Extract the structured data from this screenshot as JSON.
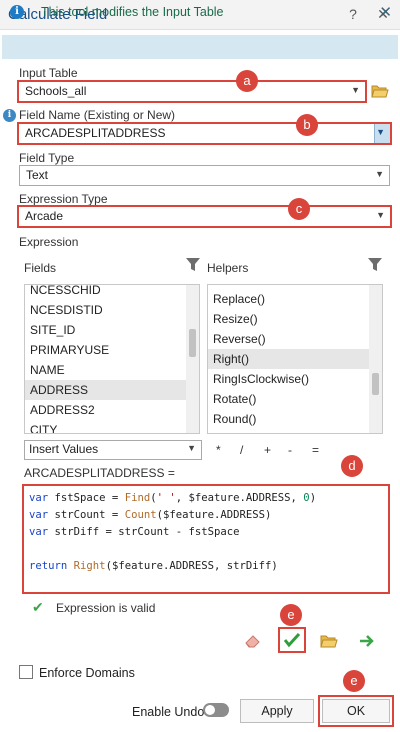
{
  "window": {
    "title": "Calculate Field",
    "help_glyph": "?",
    "close_glyph": "✕"
  },
  "banner": {
    "text": "This tool modifies the Input Table",
    "icon_glyph": "i",
    "close_glyph": "✕"
  },
  "input_table": {
    "label": "Input Table",
    "value": "Schools_all"
  },
  "field_name": {
    "label": "Field Name (Existing or New)",
    "value": "ARCADESPLITADDRESS"
  },
  "field_type": {
    "label": "Field Type",
    "value": "Text"
  },
  "expression_type": {
    "label": "Expression Type",
    "value": "Arcade"
  },
  "expression_label": "Expression",
  "fields": {
    "label": "Fields",
    "items": [
      "NCESSCHID",
      "NCESDISTID",
      "SITE_ID",
      "PRIMARYUSE",
      "NAME",
      "ADDRESS",
      "ADDRESS2",
      "CITY"
    ],
    "selected": "ADDRESS"
  },
  "helpers": {
    "label": "Helpers",
    "items": [
      "Replace()",
      "Resize()",
      "Reverse()",
      "Right()",
      "RingIsClockwise()",
      "Rotate()",
      "Round()"
    ],
    "selected": "Right()"
  },
  "insert_values": "Insert Values",
  "operators": [
    "*",
    "/",
    "+",
    "-",
    "="
  ],
  "expression_target": "ARCADESPLITADDRESS =",
  "code": {
    "l1": {
      "kw": "var",
      "a": " fstSpace = ",
      "fn": "Find",
      "b": "(",
      "str": "' '",
      "c": ", $feature.ADDRESS, ",
      "num": "0",
      "d": ")"
    },
    "l2": {
      "kw": "var",
      "a": " strCount = ",
      "fn": "Count",
      "b": "($feature.ADDRESS)"
    },
    "l3": {
      "kw": "var",
      "a": " strDiff = strCount - fstSpace"
    },
    "l5": {
      "kw": "return",
      "a": " ",
      "fn": "Right",
      "b": "($feature.ADDRESS, strDiff)"
    }
  },
  "validation": {
    "text": "Expression is valid",
    "check_glyph": "✔"
  },
  "enforce_domains": {
    "label": "Enforce Domains",
    "checked": false
  },
  "enable_undo": {
    "label": "Enable Undo",
    "on": false
  },
  "buttons": {
    "apply": "Apply",
    "ok": "OK"
  },
  "callouts": {
    "a": "a",
    "b": "b",
    "c": "c",
    "d": "d",
    "e": "e"
  },
  "colors": {
    "accent": "#1a4f86",
    "callout": "#d9443b",
    "valid": "#3aa648",
    "banner_bg": "#d5e8f2"
  }
}
